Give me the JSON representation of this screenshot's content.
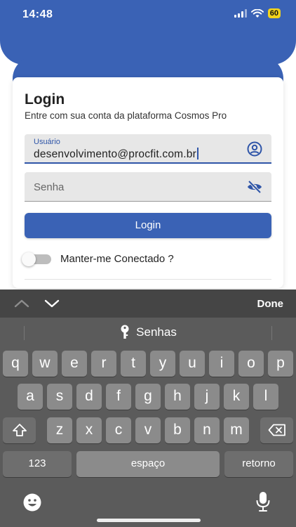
{
  "status_bar": {
    "time": "14:48",
    "battery": "60"
  },
  "login_card": {
    "title": "Login",
    "subtitle": "Entre com sua conta da plataforma Cosmos Pro",
    "username": {
      "label": "Usuário",
      "value": "desenvolvimento@procfit.com.br"
    },
    "password": {
      "placeholder": "Senha"
    },
    "login_button": "Login",
    "remember_me": {
      "label": "Manter-me Conectado ?",
      "checked": false
    }
  },
  "keyboard": {
    "done_label": "Done",
    "suggestion": "Senhas",
    "row1": [
      "q",
      "w",
      "e",
      "r",
      "t",
      "y",
      "u",
      "i",
      "o",
      "p"
    ],
    "row2": [
      "a",
      "s",
      "d",
      "f",
      "g",
      "h",
      "j",
      "k",
      "l"
    ],
    "row3": [
      "z",
      "x",
      "c",
      "v",
      "b",
      "n",
      "m"
    ],
    "numbers_key": "123",
    "space_key": "espaço",
    "return_key": "retorno",
    "icons": [
      "chevron-up-icon",
      "chevron-down-icon",
      "key-icon",
      "shift-icon",
      "backspace-icon",
      "emoji-icon",
      "microphone-icon"
    ]
  },
  "colors": {
    "brand": "#3a62b5",
    "keyboard_bg": "#5b5b5b",
    "key_bg": "#8b8b8b",
    "battery": "#f2d31c"
  }
}
